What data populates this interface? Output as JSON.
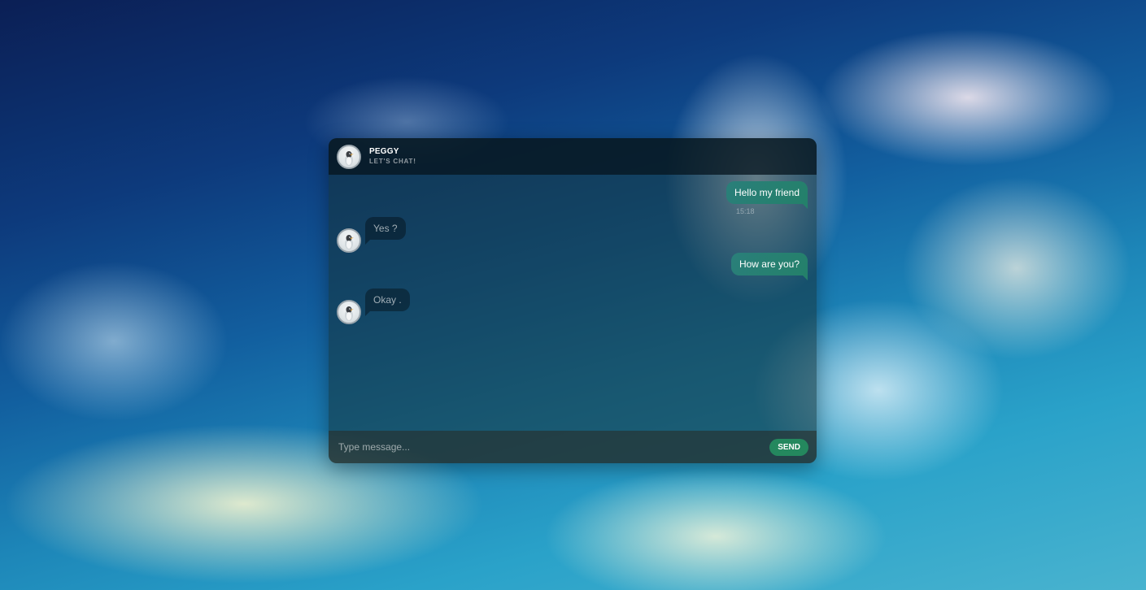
{
  "header": {
    "name": "PEGGY",
    "status": "LET'S CHAT!"
  },
  "messages": [
    {
      "direction": "outgoing",
      "text": "Hello my friend",
      "time": "15:18"
    },
    {
      "direction": "incoming",
      "text": "Yes ?"
    },
    {
      "direction": "outgoing",
      "text": "How are you?"
    },
    {
      "direction": "incoming",
      "text": "Okay ."
    }
  ],
  "composer": {
    "placeholder": "Type message...",
    "send_label": "SEND"
  },
  "colors": {
    "accent": "#24885e",
    "outgoing_bubble": "#2a7f7a"
  }
}
